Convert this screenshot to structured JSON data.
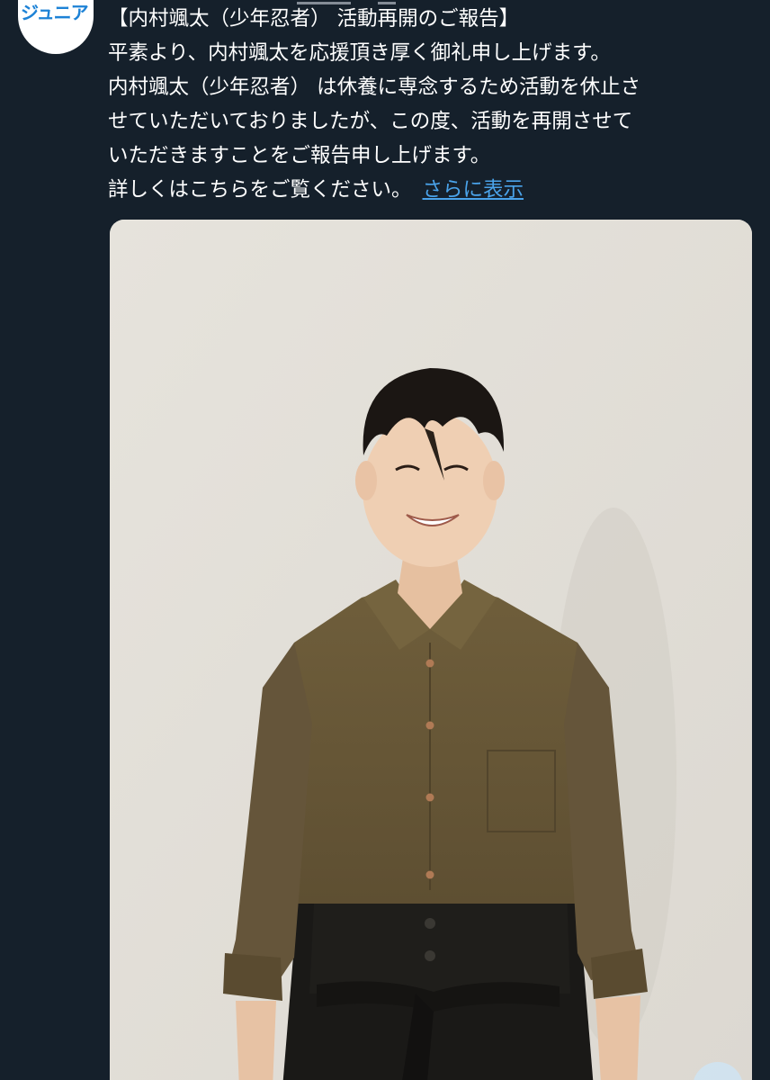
{
  "avatar": {
    "label": "ジュニア",
    "bg_color": "#ffffff",
    "text_color": "#1d82d6"
  },
  "tweet": {
    "lines": [
      "【内村颯太（少年忍者） 活動再開のご報告】",
      "平素より、内村颯太を応援頂き厚く御礼申し上げます。",
      "内村颯太（少年忍者） は休養に専念するため活動を休止さ",
      "せていただいておりましたが、この度、活動を再開させて",
      "いただきますことをご報告申し上げます。",
      "詳しくはこちらをご覧ください。"
    ],
    "show_more_label": "さらに表示",
    "link_color": "#4aa3ea"
  },
  "media": {
    "icon": "photo-of-person"
  },
  "theme": {
    "background": "#15202b",
    "text": "#ffffff"
  }
}
